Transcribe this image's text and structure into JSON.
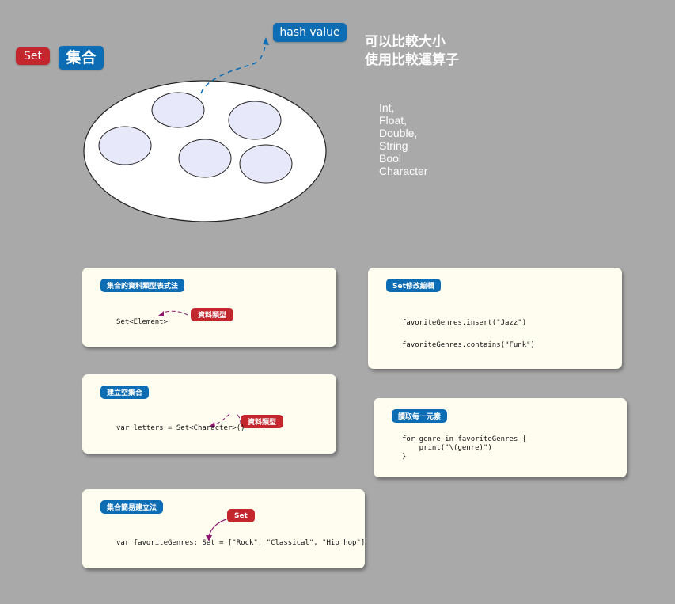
{
  "top": {
    "set_badge": "Set",
    "set_title": "集合",
    "hash_value_label": "hash value",
    "note_line1": "可以比較大小",
    "note_line2": "使用比較運算子",
    "hashable_types": [
      "Int,",
      "Float,",
      "Double,",
      "String",
      "Bool",
      "Character"
    ]
  },
  "cards": {
    "type_notation": {
      "title": "集合的資料類型表式法",
      "code": "Set<Element>",
      "tag": "資料類型"
    },
    "empty_set": {
      "title": "建立空集合",
      "code": "var letters = Set<Character>()",
      "tag": "資料類型"
    },
    "shorthand": {
      "title": "集合簡易建立法",
      "code": "var favoriteGenres: Set = [\"Rock\", \"Classical\", \"Hip hop\"]",
      "tag": "Set"
    },
    "modify": {
      "title": "Set修改編輯",
      "code_line1": "favoriteGenres.insert(\"Jazz\")",
      "code_line2": "favoriteGenres.contains(\"Funk\")"
    },
    "iterate": {
      "title": "讀取每一元素",
      "code": "for genre in favoriteGenres {\n    print(\"\\(genre)\")\n}"
    }
  },
  "colors": {
    "red_badge": "#c4262e",
    "blue_badge": "#0c6db5",
    "element_fill": "#e8e8fb",
    "card_bg": "#fefdf0",
    "background": "#a9a9a9"
  }
}
